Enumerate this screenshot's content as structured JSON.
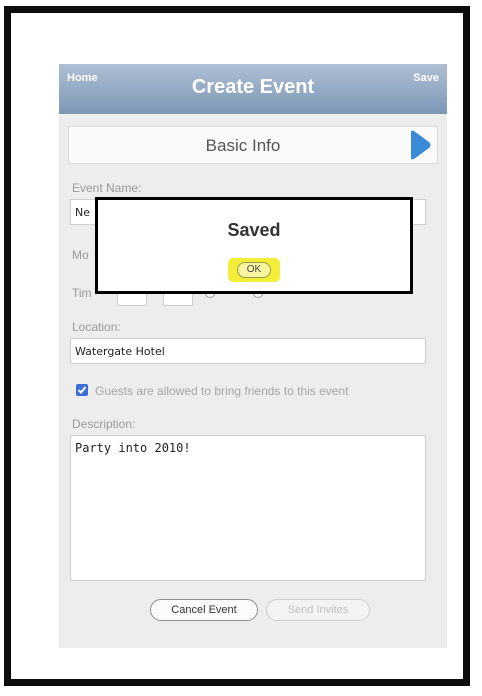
{
  "navbar": {
    "left_label": "Home",
    "title": "Create Event",
    "right_label": "Save"
  },
  "section": {
    "title": "Basic Info",
    "next_icon": "arrow-right-icon"
  },
  "event_name": {
    "label": "Event Name:",
    "value": "Ne"
  },
  "month": {
    "label": "Mo"
  },
  "time": {
    "label": "Tim"
  },
  "location": {
    "label": "Location:",
    "value": "Watergate Hotel"
  },
  "guests": {
    "checked": true,
    "label": "Guests are allowed to bring friends to this event"
  },
  "description": {
    "label": "Description:",
    "value": "Party into 2010!"
  },
  "buttons": {
    "cancel": "Cancel Event",
    "send": "Send Invites"
  },
  "dialog": {
    "title": "Saved",
    "ok_label": "OK"
  },
  "colors": {
    "navbar": "#8ea4c0",
    "accent": "#3b8ad8",
    "ok_highlight": "#f3ee3a"
  }
}
